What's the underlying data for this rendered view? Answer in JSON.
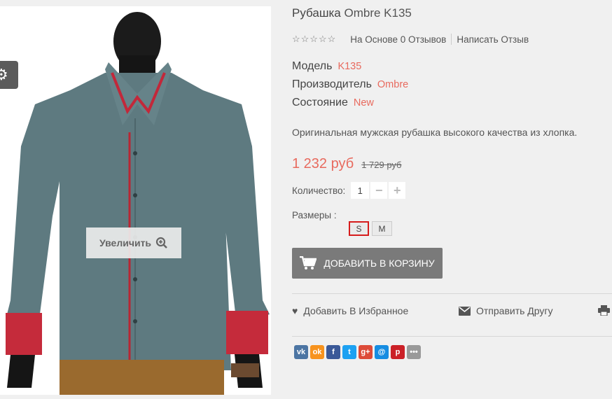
{
  "product": {
    "name": "Рубашка",
    "model_title": "Ombre K135"
  },
  "image": {
    "zoom_label": "Увеличить"
  },
  "rating": {
    "reviews_text": "На Основе 0 Отзывов",
    "write_review": "Написать Отзыв"
  },
  "specs": [
    {
      "label": "Модель",
      "value": "K135"
    },
    {
      "label": "Производитель",
      "value": "Ombre"
    },
    {
      "label": "Состояние",
      "value": "New"
    }
  ],
  "description": "Оригинальная мужская рубашка высокого качества из хлопка.",
  "price": {
    "current": "1 232 руб",
    "old": "1 729 руб"
  },
  "quantity": {
    "label": "Количество:",
    "value": "1",
    "minus": "−",
    "plus": "+"
  },
  "sizes": {
    "label": "Размеры :",
    "options": [
      "S",
      "M"
    ],
    "selected": "S"
  },
  "cart": {
    "label": "ДОБАВИТЬ В КОРЗИНУ"
  },
  "actions": {
    "wishlist": "Добавить В Избранное",
    "send_friend": "Отправить Другу"
  },
  "social": [
    {
      "icon": "vk-icon",
      "glyph": "vk",
      "color": "#4c75a3"
    },
    {
      "icon": "odnoklassniki-icon",
      "glyph": "ok",
      "color": "#f7931e"
    },
    {
      "icon": "facebook-icon",
      "glyph": "f",
      "color": "#3b5998"
    },
    {
      "icon": "twitter-icon",
      "glyph": "t",
      "color": "#1da1f2"
    },
    {
      "icon": "google-plus-icon",
      "glyph": "g+",
      "color": "#dd4b39"
    },
    {
      "icon": "mail-icon",
      "glyph": "@",
      "color": "#168de2"
    },
    {
      "icon": "pinterest-icon",
      "glyph": "p",
      "color": "#cb2027"
    },
    {
      "icon": "more-icon",
      "glyph": "•••",
      "color": "#999999"
    }
  ],
  "colors": {
    "accent": "#e86a5e",
    "cart_button": "#7a7a7a",
    "selected_size": "#d61c1c"
  }
}
